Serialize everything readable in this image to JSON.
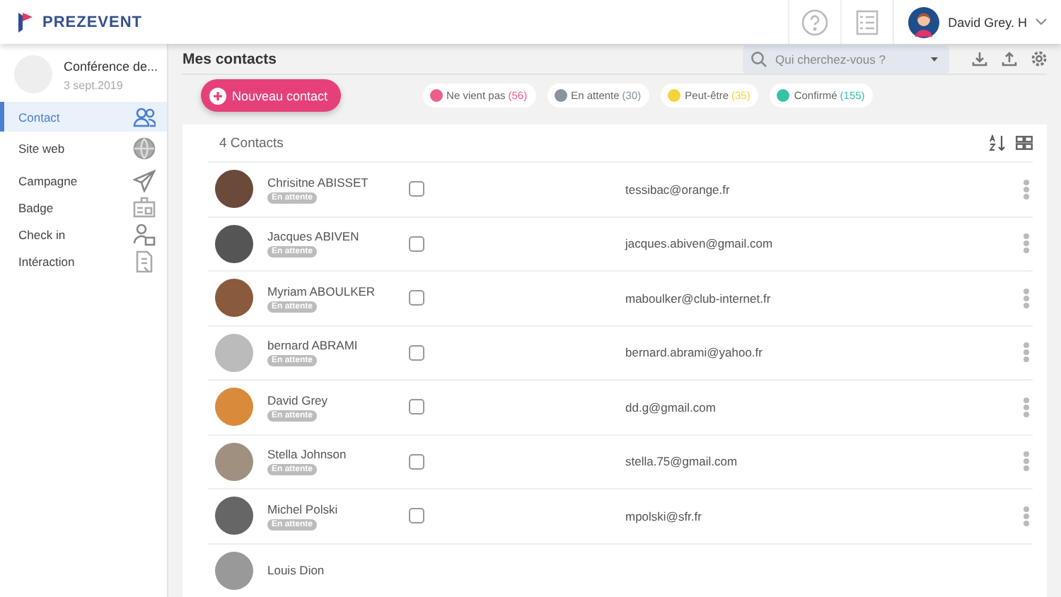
{
  "header": {
    "brand": "PREZEVENT",
    "user": "David Grey. H"
  },
  "event": {
    "title": "Conférence de...",
    "date": "3 sept.2019"
  },
  "sidebar": {
    "items": [
      {
        "label": "Contact",
        "selected": true
      },
      {
        "label": "Site web",
        "selected": false
      },
      {
        "label": "Campagne",
        "selected": false
      },
      {
        "label": "Badge",
        "selected": false
      },
      {
        "label": "Check in",
        "selected": false
      },
      {
        "label": "Intéraction",
        "selected": false
      }
    ]
  },
  "page_title": "Mes contacts",
  "search": {
    "placeholder": "Qui cherchez-vous ?"
  },
  "new_button": "Nouveau contact",
  "filters": [
    {
      "label": "Ne vient pas",
      "count": "(56)",
      "color": "#ec5f8a"
    },
    {
      "label": "En attente",
      "count": "(30)",
      "color": "#8a929c"
    },
    {
      "label": "Peut-être",
      "count": "(35)",
      "color": "#f5d33b"
    },
    {
      "label": "Confirmé",
      "count": "(155)",
      "color": "#35c2a9"
    }
  ],
  "contacts_count": "4 Contacts",
  "contacts": [
    {
      "name": "Chrisitne ABISSET",
      "status": "En attente",
      "checked": false,
      "email": "tessibac@orange.fr"
    },
    {
      "name": "Jacques ABIVEN",
      "status": "En attente",
      "checked": false,
      "email": "jacques.abiven@gmail.com"
    },
    {
      "name": "Myriam ABOULKER",
      "status": "En attente",
      "checked": false,
      "email": "maboulker@club-internet.fr"
    },
    {
      "name": "bernard ABRAMI",
      "status": "En attente",
      "checked": false,
      "email": "bernard.abrami@yahoo.fr"
    },
    {
      "name": "David Grey",
      "status": "En attente",
      "checked": false,
      "email": "dd.g@gmail.com"
    },
    {
      "name": "Stella Johnson",
      "status": "En attente",
      "checked": false,
      "email": "stella.75@gmail.com"
    },
    {
      "name": "Michel Polski",
      "status": "En attente",
      "checked": false,
      "email": "mpolski@sfr.fr"
    },
    {
      "name": "Louis Dion"
    }
  ]
}
